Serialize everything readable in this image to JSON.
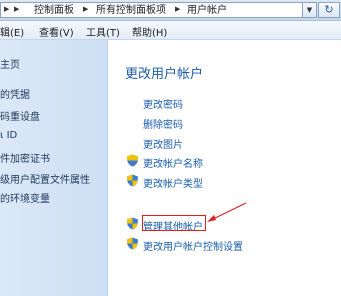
{
  "address": {
    "crumbs": [
      "控制面板",
      "所有控制面板项",
      "用户帐户"
    ]
  },
  "menu": [
    "辑(E)",
    "查看(V)",
    "工具(T)",
    "帮助(H)"
  ],
  "sidebar": [
    "主页",
    "的凭据",
    "码重设盘",
    "ID",
    "件加密证书",
    "级用户配置文件属性",
    "的环境变量"
  ],
  "main": {
    "title": "更改用户帐户",
    "links": [
      "更改密码",
      "删除密码",
      "更改图片",
      "更改帐户名称",
      "更改帐户类型",
      "管理其他帐户",
      "更改用户帐户控制设置"
    ]
  },
  "colors": {
    "link": "#1a5dab",
    "title": "#1e5ea8",
    "highlight": "#e02020"
  }
}
